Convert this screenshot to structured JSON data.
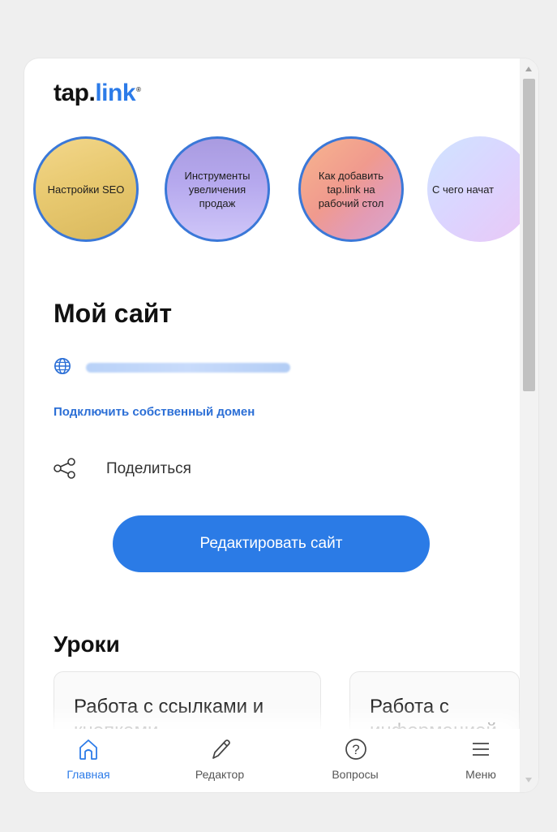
{
  "logo": {
    "part1": "tap.",
    "part2": "link",
    "mark": "®"
  },
  "stories": [
    {
      "label": "Настройки SEO"
    },
    {
      "label": "Инструменты увеличения продаж"
    },
    {
      "label": "Как добавить tap.link на рабочий стол"
    },
    {
      "label": "С чего начат"
    }
  ],
  "site": {
    "title": "Мой сайт",
    "connect_domain": "Подключить собственный домен",
    "share_label": "Поделиться",
    "edit_button": "Редактировать сайт"
  },
  "lessons": {
    "title": "Уроки",
    "cards": [
      {
        "label": "Работа с ссылками и кнопками"
      },
      {
        "label": "Работа с информацией"
      }
    ]
  },
  "nav": {
    "items": [
      {
        "label": "Главная",
        "icon": "home-icon",
        "active": true
      },
      {
        "label": "Редактор",
        "icon": "pencil-icon"
      },
      {
        "label": "Вопросы",
        "icon": "question-icon"
      },
      {
        "label": "Меню",
        "icon": "menu-icon"
      }
    ]
  },
  "colors": {
    "accent": "#2b7be6",
    "link": "#2c6fd6",
    "background": "#efefef"
  }
}
